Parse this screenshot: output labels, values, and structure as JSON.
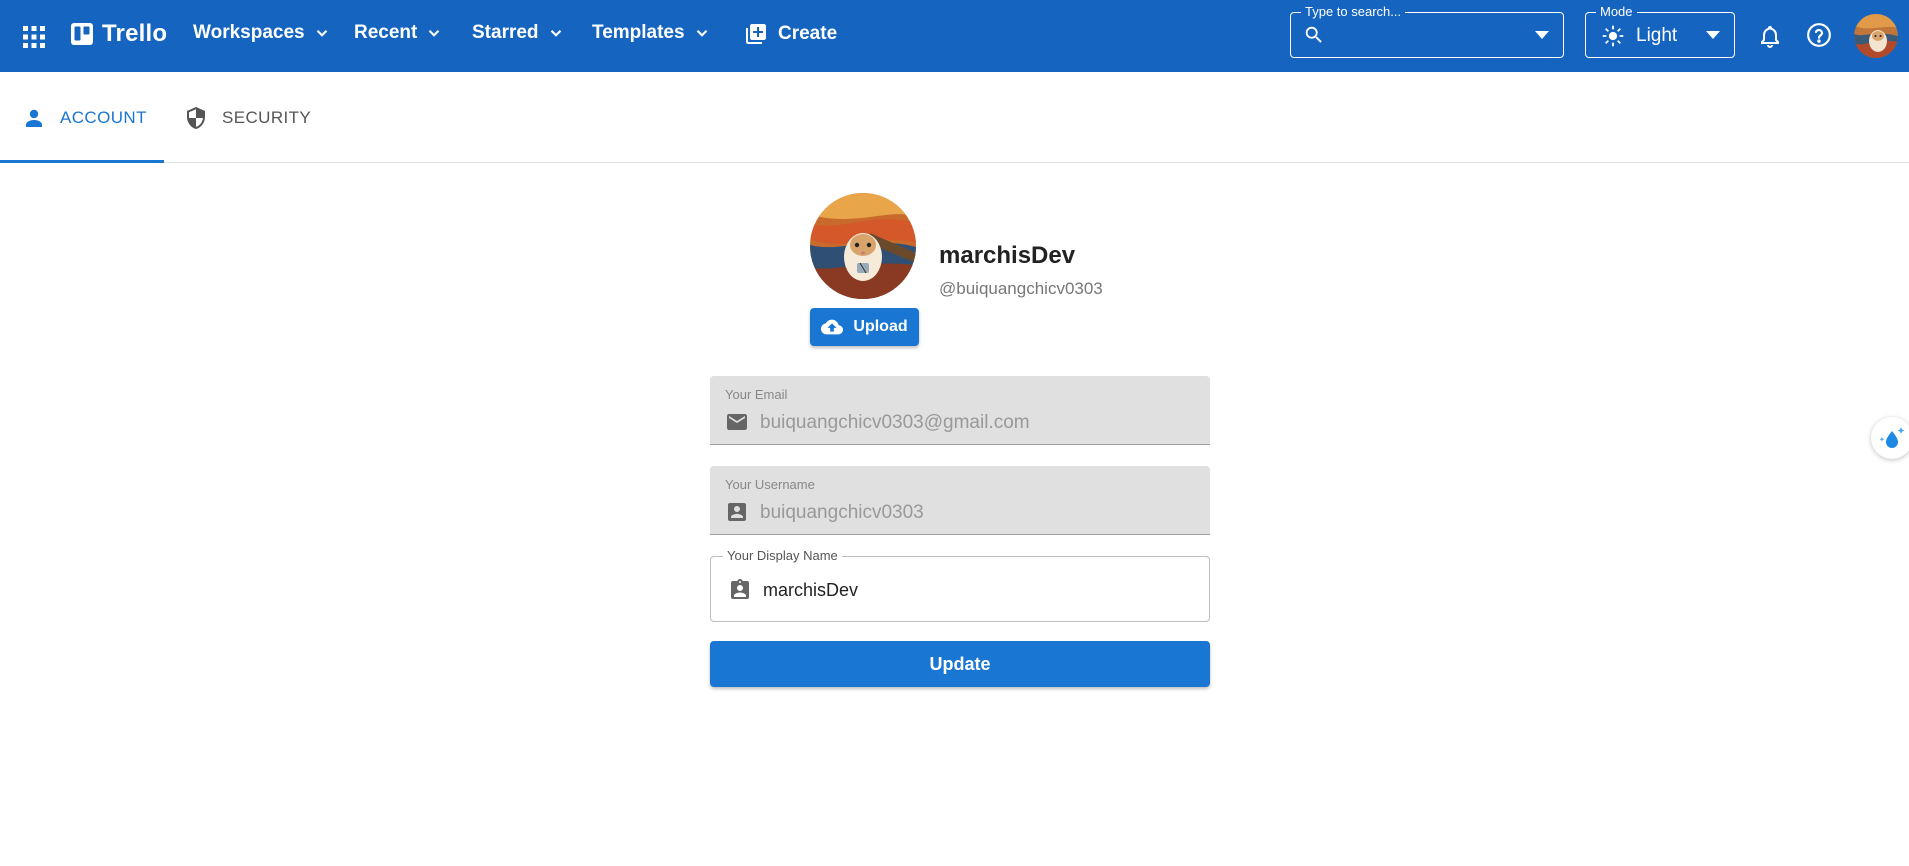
{
  "brand": {
    "name": "Trello"
  },
  "nav": {
    "workspaces": "Workspaces",
    "recent": "Recent",
    "starred": "Starred",
    "templates": "Templates",
    "create": "Create"
  },
  "search": {
    "label": "Type to search...",
    "value": ""
  },
  "mode": {
    "label": "Mode",
    "value": "Light"
  },
  "tabs": [
    {
      "label": "ACCOUNT",
      "icon": "person-icon",
      "active": true
    },
    {
      "label": "SECURITY",
      "icon": "shield-icon",
      "active": false
    }
  ],
  "profile": {
    "display_name": "marchisDev",
    "handle": "@buiquangchicv0303",
    "upload_label": "Upload"
  },
  "form": {
    "email": {
      "label": "Your Email",
      "value": "buiquangchicv0303@gmail.com",
      "disabled": true
    },
    "username": {
      "label": "Your Username",
      "value": "buiquangchicv0303",
      "disabled": true
    },
    "display_name": {
      "label": "Your Display Name",
      "value": "marchisDev"
    },
    "submit_label": "Update"
  },
  "colors": {
    "header": "#1565c0",
    "accent": "#1976d2",
    "disabled_field": "#e0e0e0"
  }
}
